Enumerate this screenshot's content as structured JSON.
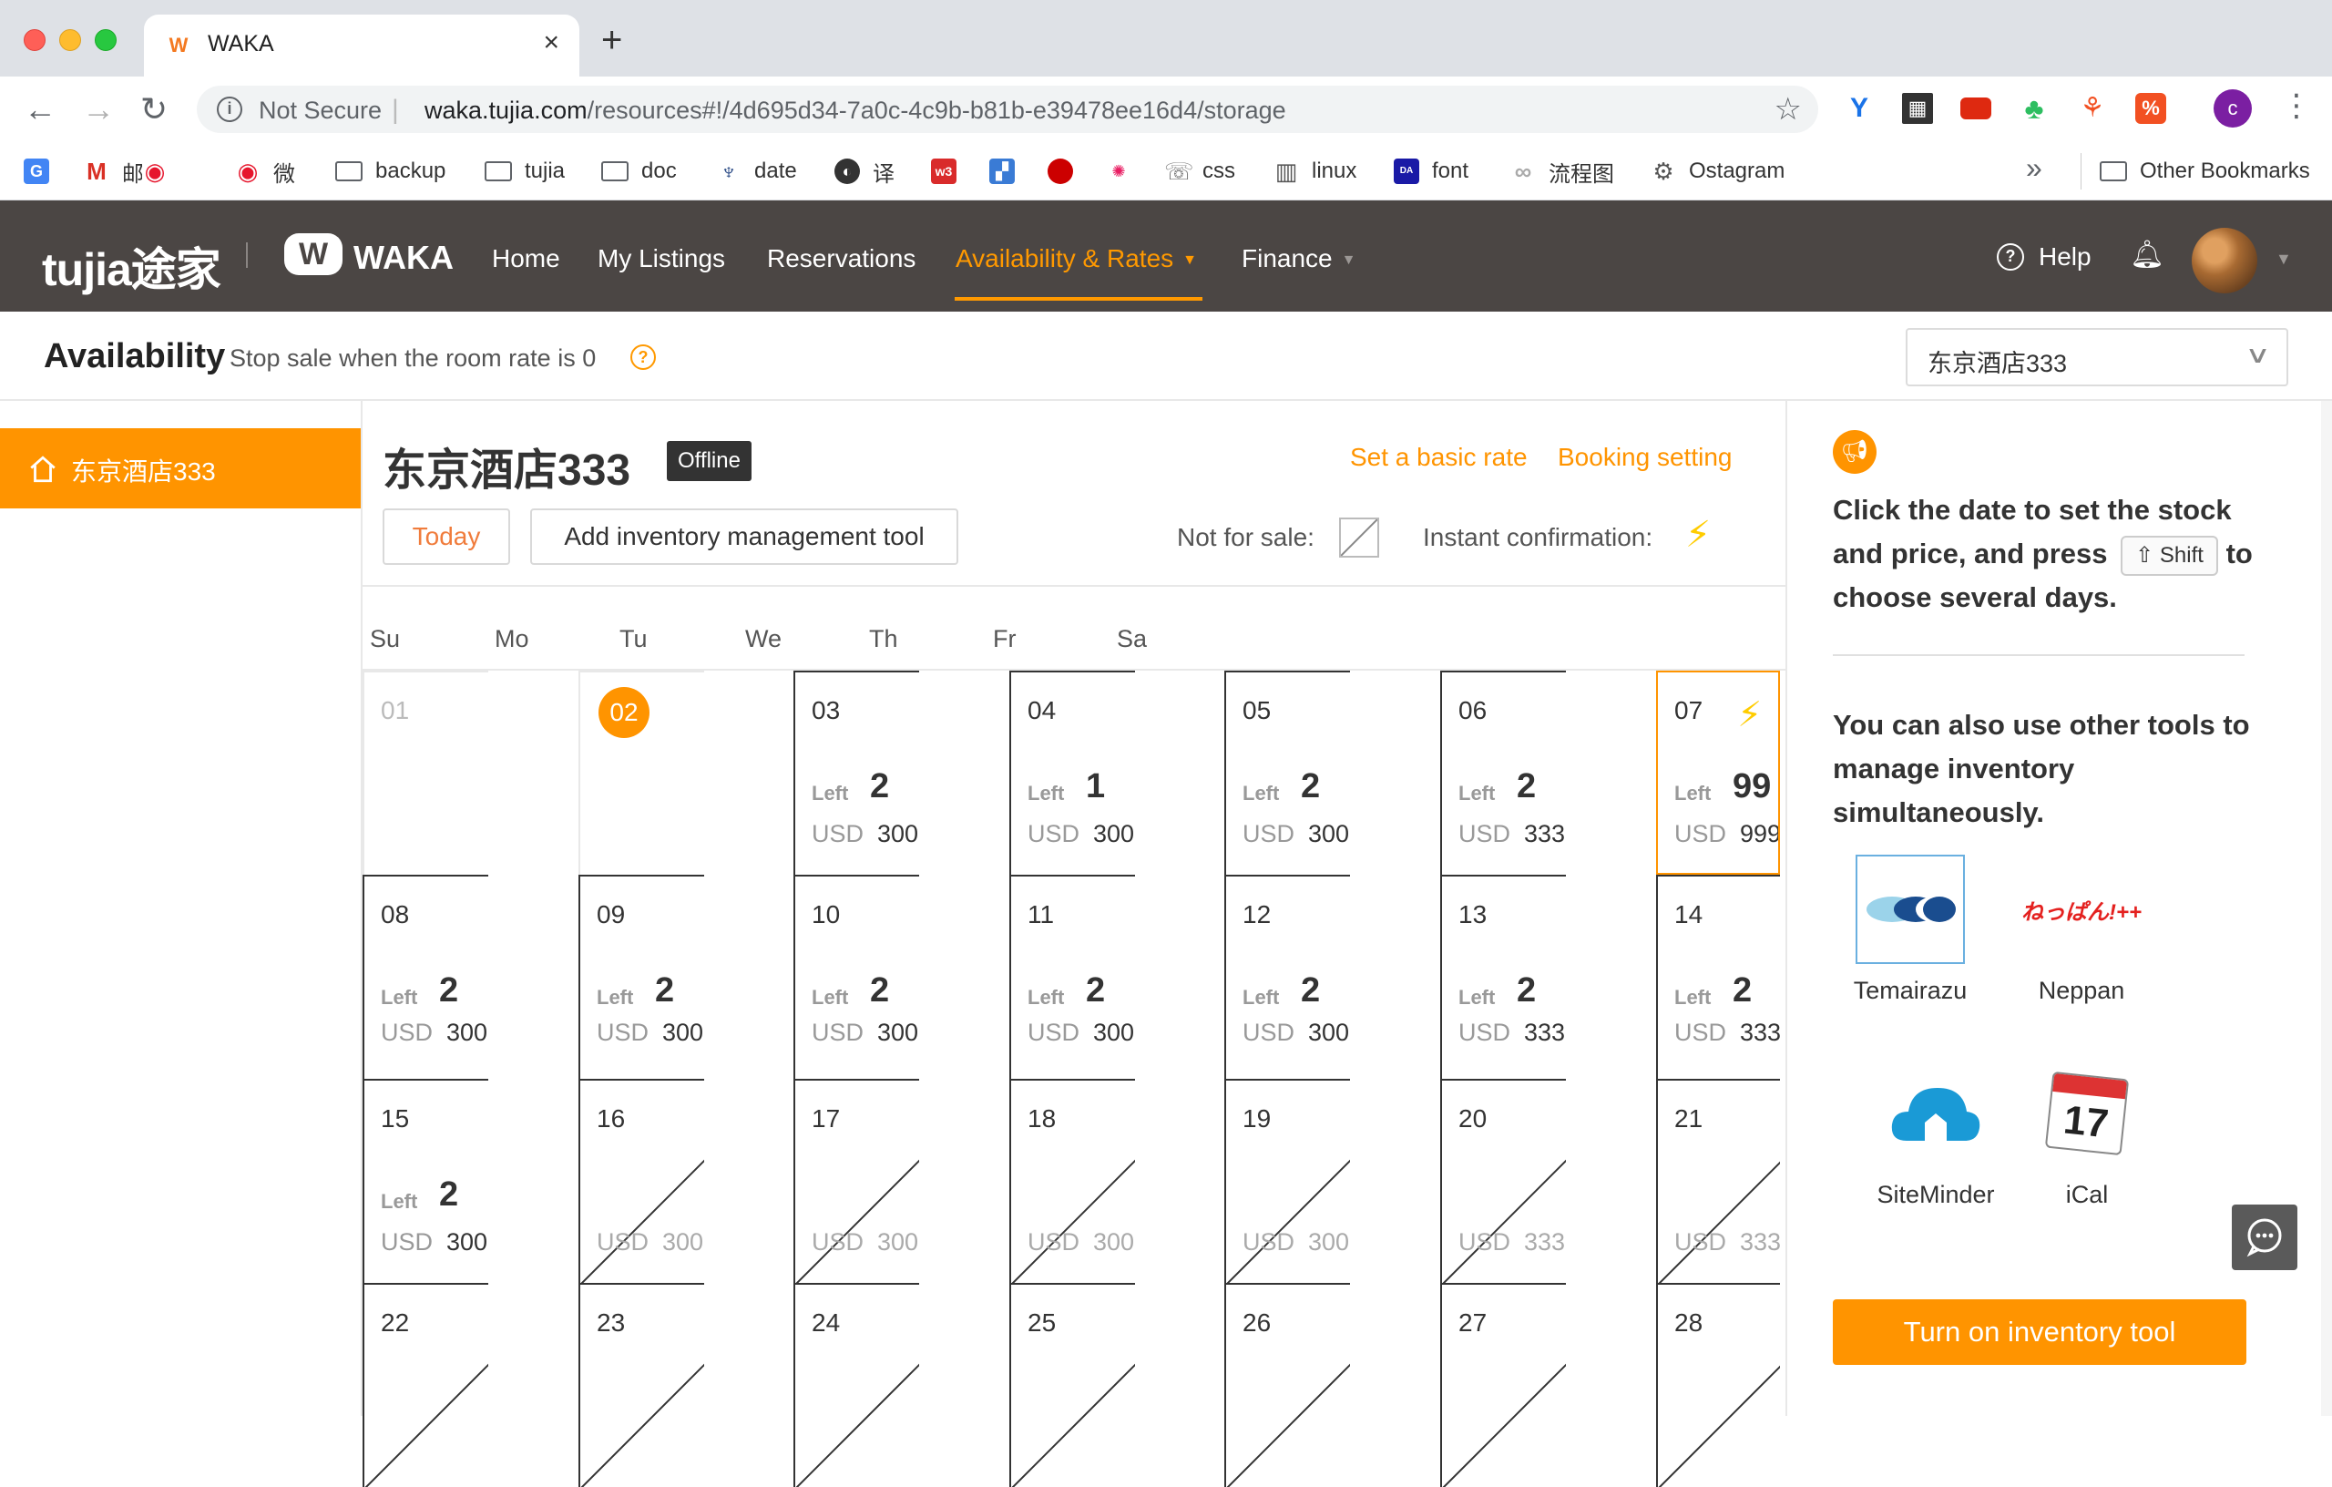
{
  "browser": {
    "tab_title": "WAKA",
    "security_label": "Not Secure",
    "url_host": "waka.tujia.com",
    "url_path": "/resources#!/4d695d34-7a0c-4c9b-b81b-e39478ee16d4/storage",
    "profile_initial": "c",
    "bookmarks": [
      "邮",
      "微",
      "backup",
      "tujia",
      "doc",
      "date",
      "译",
      "css",
      "linux",
      "font",
      "流程图",
      "Ostagram"
    ],
    "other_bookmarks": "Other Bookmarks"
  },
  "app": {
    "logo_tujia": "tujia途家",
    "logo_waka": "WAKA",
    "nav": {
      "home": "Home",
      "listings": "My Listings",
      "reservations": "Reservations",
      "availability": "Availability & Rates",
      "finance": "Finance"
    },
    "help": "Help"
  },
  "page": {
    "title": "Availability",
    "subtitle": "Stop sale when the room rate is 0",
    "property_select": "东京酒店333"
  },
  "sidebar": {
    "item": "东京酒店333"
  },
  "main": {
    "hotel_name": "东京酒店333",
    "status_badge": "Offline",
    "set_basic_rate": "Set a basic rate",
    "booking_setting": "Booking setting",
    "today_btn": "Today",
    "add_tool_btn": "Add inventory management tool",
    "not_for_sale_label": "Not for sale:",
    "instant_conf_label": "Instant confirmation:",
    "left_label": "Left",
    "currency": "USD",
    "weekdays": [
      "Su",
      "Mo",
      "Tu",
      "We",
      "Th",
      "Fr",
      "Sa"
    ],
    "weeks": [
      [
        {
          "date": "01",
          "past": true
        },
        {
          "date": "02",
          "today": true
        },
        {
          "date": "03",
          "left": "2",
          "price": "300"
        },
        {
          "date": "04",
          "left": "1",
          "price": "300"
        },
        {
          "date": "05",
          "left": "2",
          "price": "300"
        },
        {
          "date": "06",
          "left": "2",
          "price": "333"
        },
        {
          "date": "07",
          "left": "99",
          "price": "999",
          "instant": true,
          "selected": true
        }
      ],
      [
        {
          "date": "08",
          "left": "2",
          "price": "300"
        },
        {
          "date": "09",
          "left": "2",
          "price": "300"
        },
        {
          "date": "10",
          "left": "2",
          "price": "300"
        },
        {
          "date": "11",
          "left": "2",
          "price": "300"
        },
        {
          "date": "12",
          "left": "2",
          "price": "300"
        },
        {
          "date": "13",
          "left": "2",
          "price": "333"
        },
        {
          "date": "14",
          "left": "2",
          "price": "333"
        }
      ],
      [
        {
          "date": "15",
          "left": "2",
          "price": "300"
        },
        {
          "date": "16",
          "price": "300",
          "not_for_sale": true
        },
        {
          "date": "17",
          "price": "300",
          "not_for_sale": true
        },
        {
          "date": "18",
          "price": "300",
          "not_for_sale": true
        },
        {
          "date": "19",
          "price": "300",
          "not_for_sale": true
        },
        {
          "date": "20",
          "price": "333",
          "not_for_sale": true
        },
        {
          "date": "21",
          "price": "333",
          "not_for_sale": true
        }
      ],
      [
        {
          "date": "22",
          "not_for_sale": true
        },
        {
          "date": "23",
          "not_for_sale": true
        },
        {
          "date": "24",
          "not_for_sale": true
        },
        {
          "date": "25",
          "not_for_sale": true
        },
        {
          "date": "26",
          "not_for_sale": true
        },
        {
          "date": "27",
          "not_for_sale": true
        },
        {
          "date": "28",
          "not_for_sale": true
        }
      ]
    ]
  },
  "right_panel": {
    "tip_part1": "Click the date to set the stock and price, and press",
    "shift_key": "Shift",
    "tip_part2": "to choose several days.",
    "tools_heading": "You can also use other tools to manage inventory simultaneously.",
    "tools": [
      "Temairazu",
      "Neppan",
      "SiteMinder",
      "iCal"
    ],
    "neppan_logo_text": "ねっぱん!++",
    "ical_day": "17",
    "turn_on_btn": "Turn on inventory tool"
  },
  "colors": {
    "accent": "#ff9400",
    "header_bg": "#4b4644",
    "bolt": "#ffcc00"
  }
}
